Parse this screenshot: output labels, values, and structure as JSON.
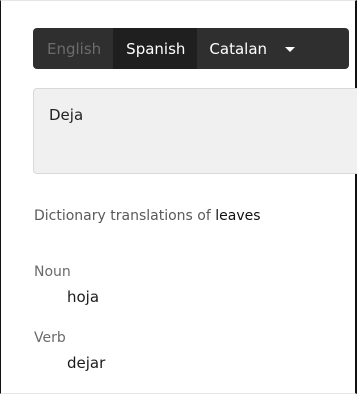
{
  "languages": {
    "items": [
      {
        "label": "English",
        "state": "disabled"
      },
      {
        "label": "Spanish",
        "state": "selected"
      },
      {
        "label": "Catalan",
        "state": "normal"
      }
    ],
    "dropdown_icon": "caret-down-icon"
  },
  "translation": {
    "text": "Deja"
  },
  "dictionary": {
    "heading_prefix": "Dictionary translations of",
    "word": "leaves",
    "entries": [
      {
        "pos": "Noun",
        "translation": "hoja"
      },
      {
        "pos": "Verb",
        "translation": "dejar"
      }
    ]
  }
}
